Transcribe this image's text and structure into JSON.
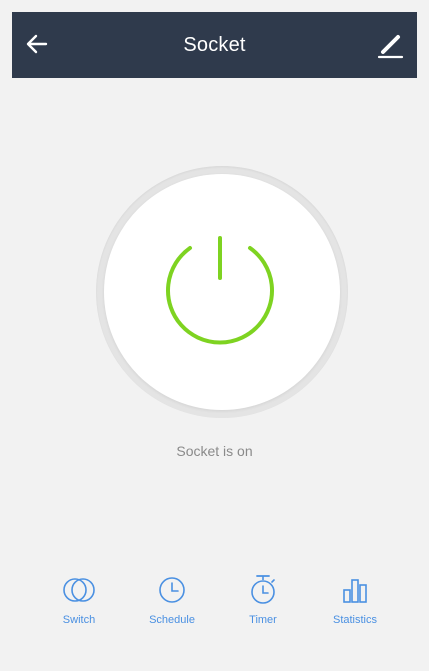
{
  "header": {
    "title": "Socket",
    "back_icon": "arrow-left-icon",
    "edit_icon": "pencil-icon",
    "background": "#2f3a4c",
    "text_color": "#ffffff"
  },
  "power": {
    "state": "on",
    "status_text": "Socket is on",
    "icon": "power-icon",
    "on_color": "#7ed321",
    "ring_color": "#e4e4e4"
  },
  "bottom_nav": {
    "accent_color": "#4a90e2",
    "items": [
      {
        "label": "Switch",
        "icon": "switch-icon"
      },
      {
        "label": "Schedule",
        "icon": "clock-icon"
      },
      {
        "label": "Timer",
        "icon": "stopwatch-icon"
      },
      {
        "label": "Statistics",
        "icon": "bar-chart-icon"
      }
    ]
  }
}
